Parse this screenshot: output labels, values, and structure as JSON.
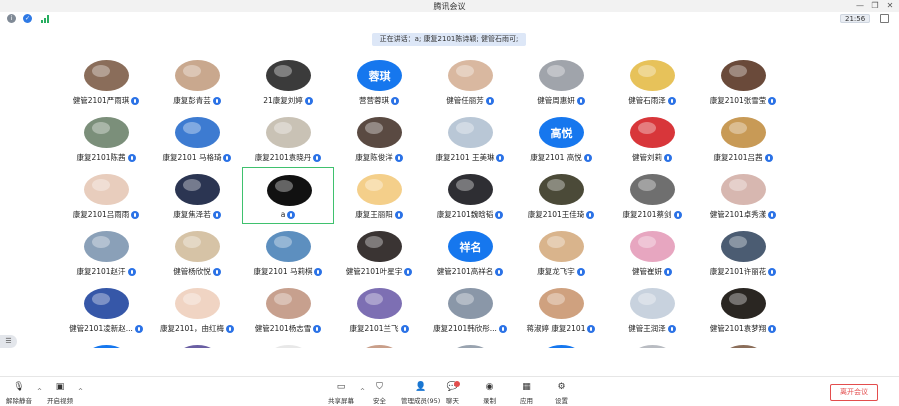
{
  "window": {
    "title": "腾讯会议"
  },
  "infobar": {
    "time": "21:56"
  },
  "speaking_banner": "正在讲话：a; 康复2101陈诗颖; 健管石雨可;",
  "participants": [
    {
      "name": "健管2101严雨琪",
      "avatar_text": "",
      "color": "#8a6d5a"
    },
    {
      "name": "康复彭青芸",
      "avatar_text": "",
      "color": "#c9a88e"
    },
    {
      "name": "21康复刘婷",
      "avatar_text": "",
      "color": "#3b3b3b"
    },
    {
      "name": "营营蓉琪",
      "avatar_text": "蓉琪",
      "color": "#1677ee"
    },
    {
      "name": "健管任丽芳",
      "avatar_text": "",
      "color": "#d9b8a0"
    },
    {
      "name": "健管周惠妍",
      "avatar_text": "",
      "color": "#a0a4ab"
    },
    {
      "name": "健管石雨泽",
      "avatar_text": "",
      "color": "#e7c25a"
    },
    {
      "name": "康复2101张雪莹",
      "avatar_text": "",
      "color": "#6a4a3a"
    },
    {
      "name": "康复2101陈茜",
      "avatar_text": "",
      "color": "#7b8f7a"
    },
    {
      "name": "康复2101 马格琦",
      "avatar_text": "",
      "color": "#3d7bd1"
    },
    {
      "name": "康复2101袁晓丹",
      "avatar_text": "",
      "color": "#c9c2b5"
    },
    {
      "name": "康复陈俊洋",
      "avatar_text": "",
      "color": "#5a4a42"
    },
    {
      "name": "康复2101 王美琳",
      "avatar_text": "",
      "color": "#b9c7d6"
    },
    {
      "name": "康复2101 高悦",
      "avatar_text": "高悦",
      "color": "#1677ee"
    },
    {
      "name": "健管刘莉",
      "avatar_text": "",
      "color": "#d8363a"
    },
    {
      "name": "康复2101吕茜",
      "avatar_text": "",
      "color": "#c89a56"
    },
    {
      "name": "康复2101吕雨雨",
      "avatar_text": "",
      "color": "#e8cdbd"
    },
    {
      "name": "康复焦泽若",
      "avatar_text": "",
      "color": "#2b3552"
    },
    {
      "name": "a",
      "avatar_text": "",
      "color": "#111111"
    },
    {
      "name": "康复王丽阳",
      "avatar_text": "",
      "color": "#f4cf8a"
    },
    {
      "name": "康复2101魏晗韬",
      "avatar_text": "",
      "color": "#2e2e33"
    },
    {
      "name": "康复2101王佳琦",
      "avatar_text": "",
      "color": "#4b4a38"
    },
    {
      "name": "康复2101蔡剑",
      "avatar_text": "",
      "color": "#6f6f6f"
    },
    {
      "name": "健管2101卓秀漾",
      "avatar_text": "",
      "color": "#d7b7b0"
    },
    {
      "name": "康复2101赵汗",
      "avatar_text": "",
      "color": "#8aa0b8"
    },
    {
      "name": "健管杨欣悦",
      "avatar_text": "",
      "color": "#d6c3a6"
    },
    {
      "name": "康复2101 马莉棋",
      "avatar_text": "",
      "color": "#5d8fbf"
    },
    {
      "name": "健管2101叶星宇",
      "avatar_text": "",
      "color": "#3a3433"
    },
    {
      "name": "健管2101高祥名",
      "avatar_text": "祥名",
      "color": "#1677ee"
    },
    {
      "name": "康复龙飞宇",
      "avatar_text": "",
      "color": "#d9b48c"
    },
    {
      "name": "健管崔妍",
      "avatar_text": "",
      "color": "#e7a6c0"
    },
    {
      "name": "康复2101许丽花",
      "avatar_text": "",
      "color": "#4b5c72"
    },
    {
      "name": "健管2101凌新赵...",
      "avatar_text": "",
      "color": "#3657a8"
    },
    {
      "name": "康复2101，由红梅",
      "avatar_text": "",
      "color": "#f0d4c3"
    },
    {
      "name": "健管2101杨志雪",
      "avatar_text": "",
      "color": "#c7a08e"
    },
    {
      "name": "康复2101兰飞",
      "avatar_text": "",
      "color": "#7d6fb3"
    },
    {
      "name": "康复2101韩欣彤...",
      "avatar_text": "",
      "color": "#8a97a8"
    },
    {
      "name": "蒋淑婷 康复2101",
      "avatar_text": "",
      "color": "#cfa17f"
    },
    {
      "name": "健管王润泽",
      "avatar_text": "",
      "color": "#c8d2de"
    },
    {
      "name": "健管2101袁梦翔",
      "avatar_text": "",
      "color": "#2a2622"
    },
    {
      "name": "",
      "avatar_text": "",
      "color": "#1677ee"
    },
    {
      "name": "",
      "avatar_text": "",
      "color": "#6a5fa3"
    },
    {
      "name": "",
      "avatar_text": "",
      "color": "#e8e8e8"
    },
    {
      "name": "",
      "avatar_text": "",
      "color": "#c99f8a"
    },
    {
      "name": "",
      "avatar_text": "",
      "color": "#9aa4b0"
    },
    {
      "name": "",
      "avatar_text": "",
      "color": "#1677ee"
    },
    {
      "name": "",
      "avatar_text": "",
      "color": "#b9bcc2"
    },
    {
      "name": "",
      "avatar_text": "",
      "color": "#8b6e5a"
    }
  ],
  "active_speaker_index": 18,
  "toolbar": {
    "mute": "解除静音",
    "video": "开启视频",
    "share": "共享屏幕",
    "security": "安全",
    "members": "管理成员(95)",
    "chat": "聊天",
    "record": "录制",
    "apps": "应用",
    "settings": "设置",
    "leave": "离开会议"
  },
  "colors": {
    "accent": "#1677ee",
    "danger": "#e34d4d",
    "active_border": "#3fc16e"
  }
}
